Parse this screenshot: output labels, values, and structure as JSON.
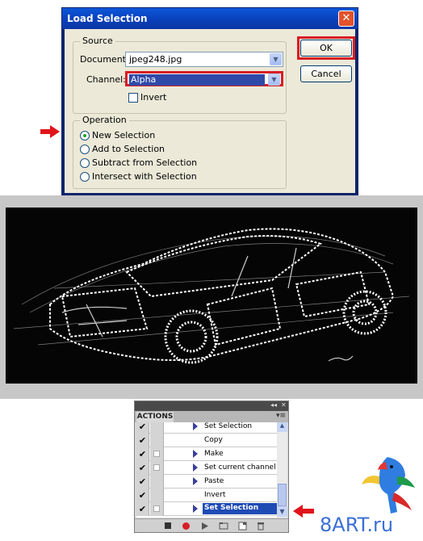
{
  "dialog": {
    "title": "Load Selection",
    "close_glyph": "✕",
    "source": {
      "legend": "Source",
      "document_label": "Document:",
      "document_value": "jpeg248.jpg",
      "channel_label": "Channel:",
      "channel_value": "Alpha",
      "invert_label": "Invert",
      "invert_checked": false
    },
    "operation": {
      "legend": "Operation",
      "options": [
        {
          "label": "New Selection",
          "selected": true
        },
        {
          "label": "Add to Selection",
          "selected": false
        },
        {
          "label": "Subtract from Selection",
          "selected": false
        },
        {
          "label": "Intersect with Selection",
          "selected": false
        }
      ]
    },
    "ok_label": "OK",
    "cancel_label": "Cancel"
  },
  "actions_panel": {
    "tab_label": "ACTIONS",
    "rows": [
      {
        "label": "Set Selection",
        "checked": true,
        "dialog_toggle": false,
        "expandable": true,
        "selected": false
      },
      {
        "label": "Copy",
        "checked": true,
        "dialog_toggle": false,
        "expandable": false,
        "selected": false
      },
      {
        "label": "Make",
        "checked": true,
        "dialog_toggle": true,
        "expandable": true,
        "selected": false
      },
      {
        "label": "Set current channel",
        "checked": true,
        "dialog_toggle": true,
        "expandable": true,
        "selected": false
      },
      {
        "label": "Paste",
        "checked": true,
        "dialog_toggle": false,
        "expandable": true,
        "selected": false
      },
      {
        "label": "Invert",
        "checked": true,
        "dialog_toggle": false,
        "expandable": false,
        "selected": false
      },
      {
        "label": "Set Selection",
        "checked": true,
        "dialog_toggle": true,
        "expandable": true,
        "selected": true
      }
    ]
  },
  "watermark": {
    "text": "8ART.ru"
  },
  "colors": {
    "highlight_red": "#d81e24",
    "selection_blue": "#1f4bb5",
    "dialog_face": "#ece9d8",
    "title_blue": "#0a46c4"
  }
}
